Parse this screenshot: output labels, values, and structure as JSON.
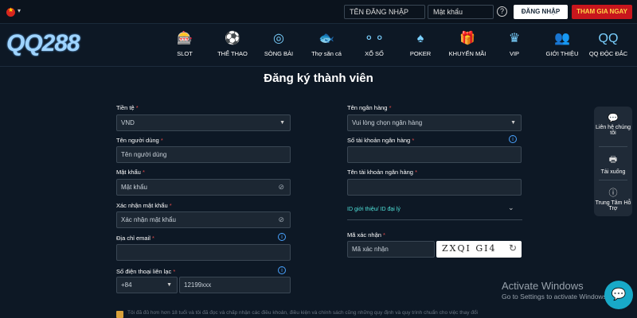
{
  "topbar": {
    "username_placeholder": "TÊN ĐĂNG NHẬP",
    "password_placeholder": "Mật khẩu",
    "help_label": "?",
    "login_button": "ĐĂNG NHẬP",
    "join_button": "THAM GIA NGAY"
  },
  "brand": {
    "logo_a": "QQ",
    "logo_b": "288"
  },
  "nav": {
    "items": [
      {
        "label": "SLOT",
        "icon": "slot-machine-icon"
      },
      {
        "label": "THỂ THAO",
        "icon": "sports-icon"
      },
      {
        "label": "SÒNG BÀI",
        "icon": "casino-icon"
      },
      {
        "label": "Thợ săn cá",
        "icon": "fish-icon"
      },
      {
        "label": "XỔ SỐ",
        "icon": "lottery-icon"
      },
      {
        "label": "POKER",
        "icon": "cards-icon"
      },
      {
        "label": "KHUYẾN MÃI",
        "icon": "gift-icon"
      },
      {
        "label": "VIP",
        "icon": "crown-icon"
      },
      {
        "label": "GIỚI THIỆU",
        "icon": "referral-icon"
      },
      {
        "label": "QQ ĐỘC ĐẮC",
        "icon": "jackpot-icon"
      }
    ]
  },
  "page_title": "Đăng ký thành viên",
  "form": {
    "currency": {
      "label": "Tiền tệ",
      "value": "VND"
    },
    "username": {
      "label": "Tên người dùng",
      "placeholder": "Tên người dùng"
    },
    "password": {
      "label": "Mật khẩu",
      "placeholder": "Mật khẩu"
    },
    "confirm_password": {
      "label": "Xác nhận mật khẩu",
      "placeholder": "Xác nhận mật khẩu"
    },
    "email": {
      "label": "Địa chỉ email",
      "value": ""
    },
    "phone": {
      "label": "Số điện thoại liên lạc",
      "code": "+84",
      "placeholder": "12199xxx"
    },
    "bank_name": {
      "label": "Tên ngân hàng",
      "value": "Vui lòng chọn ngân hàng"
    },
    "account_number": {
      "label": "Số tài khoản ngân hàng",
      "value": ""
    },
    "account_name": {
      "label": "Tên tài khoản ngân hàng",
      "value": ""
    },
    "referral": {
      "label": "ID giới thiệu/ ID đại lý"
    },
    "captcha": {
      "label": "Mã xác nhận",
      "placeholder": "Mã xác nhận",
      "code": "ZXQI GI4"
    },
    "required_mark": "*",
    "terms": "Tôi đã đủ hơn hơn 18 tuổi và tôi đã đọc và chấp nhận các điều khoản, điều kiện và chính sách cũng những quy định và quy trình chuẩn cho việc thay đổi"
  },
  "side_panel": {
    "contact": "Liên hệ chúng tôi",
    "download": "Tải xuống",
    "support": "Trung Tâm Hỗ Trợ"
  },
  "watermark": {
    "title": "Activate Windows",
    "subtitle": "Go to Settings to activate Windows."
  },
  "colors": {
    "background": "#0d1825",
    "join_button": "#c8161d",
    "join_text": "#ffd54a",
    "accent_cyan": "#4fe0d8",
    "required": "#e04848"
  }
}
